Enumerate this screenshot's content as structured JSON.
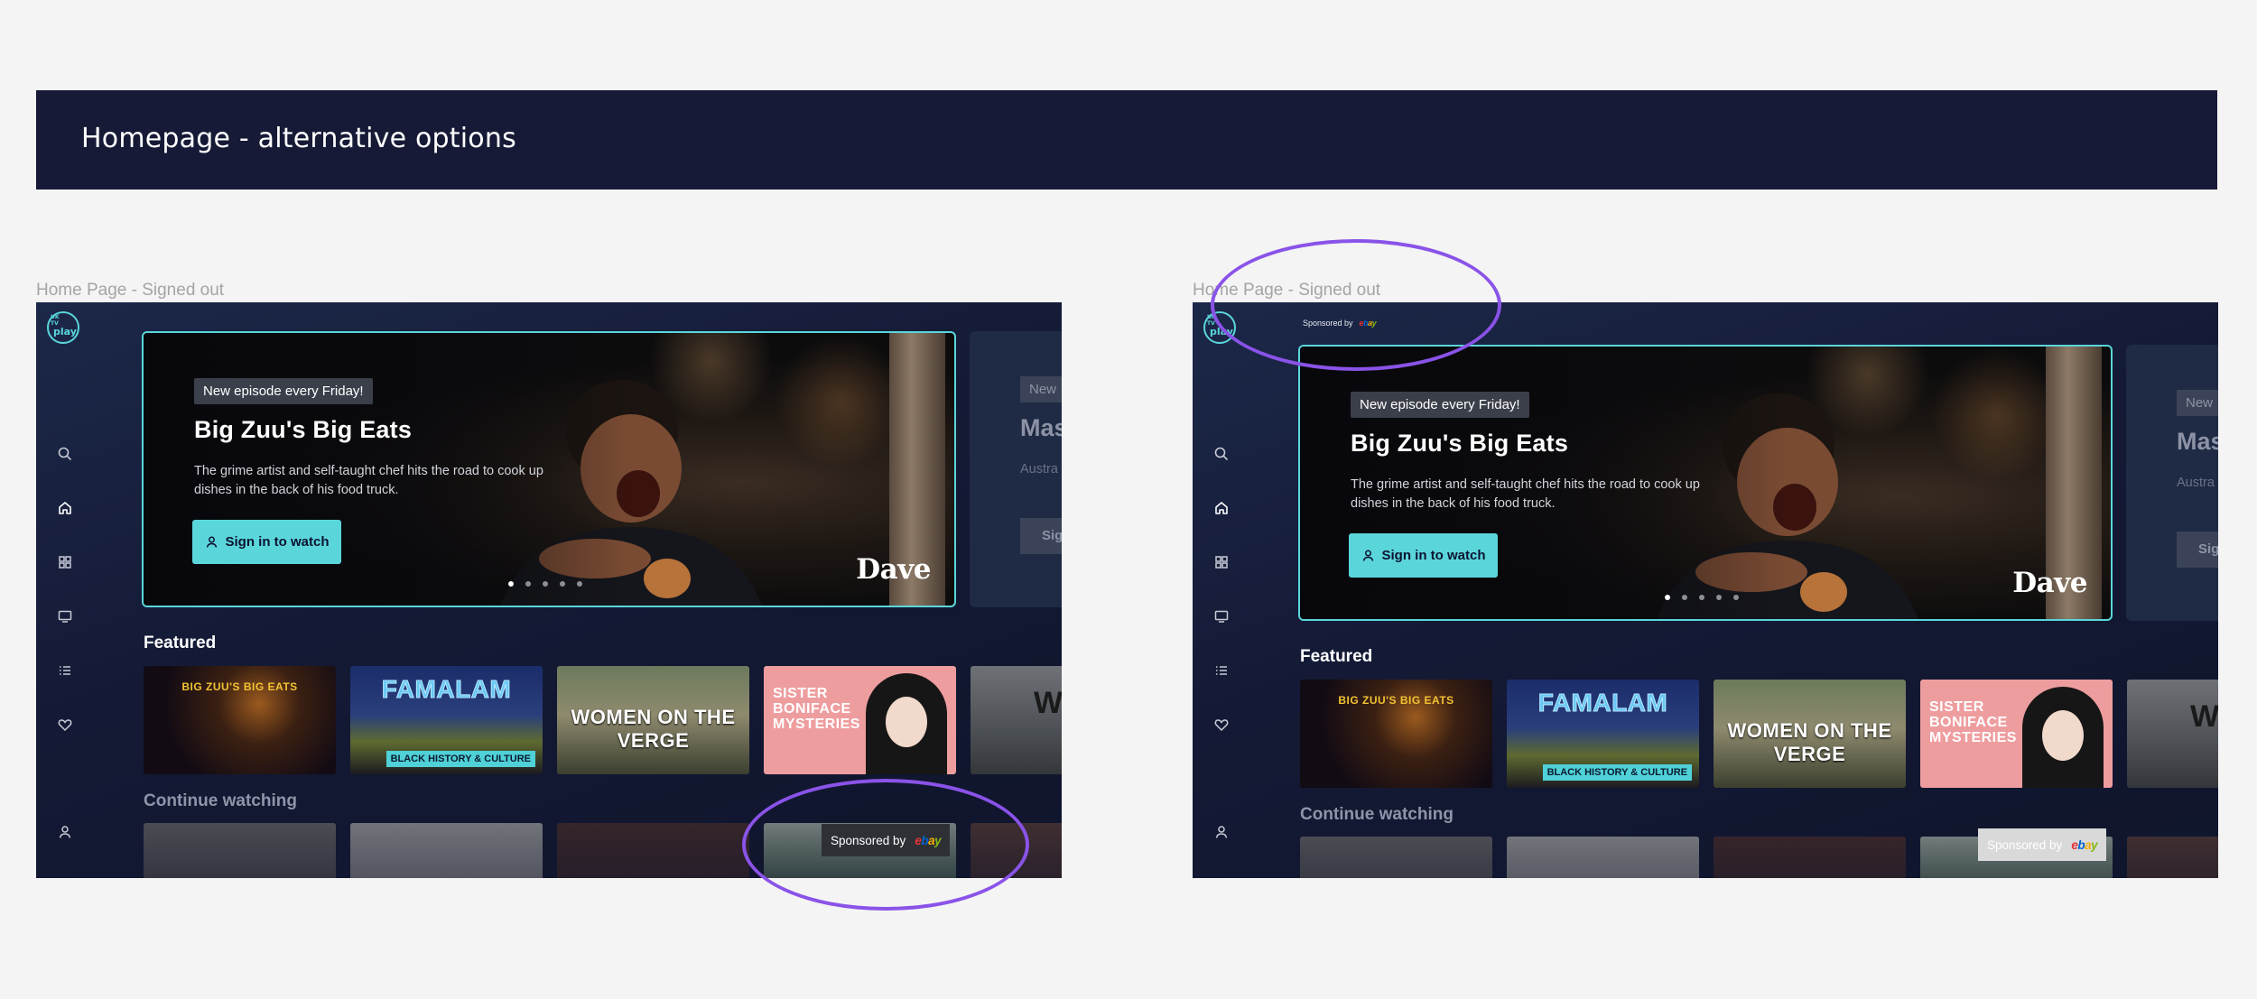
{
  "page": {
    "banner_title": "Homepage  - alternative options",
    "colors": {
      "banner_bg": "#161a36",
      "accent": "#5ad6db",
      "annotation": "#8a53e8",
      "app_bg": "#141a35"
    }
  },
  "frames": [
    {
      "caption": "Home Page - Signed out",
      "logo": {
        "top": "UK",
        "mid": "TV",
        "word": "play"
      },
      "sidebar_icons": [
        "search-icon",
        "home-icon",
        "categories-icon",
        "tv-guide-icon",
        "list-icon",
        "favourites-icon",
        "profile-icon"
      ],
      "hero": {
        "badge": "New episode every Friday!",
        "title": "Big Zuu's Big Eats",
        "description": "The grime artist and self-taught chef hits the road to cook up dishes in the back of his food truck.",
        "cta": "Sign in to watch",
        "channel": "Dave",
        "active_slide": 1,
        "slide_count": 5
      },
      "next_hero": {
        "badge": "New",
        "title": "Mas",
        "description": "Austra origina",
        "cta": "Sig"
      },
      "featured_label": "Featured",
      "featured": [
        {
          "title": "BIG ZUU'S BIG EATS"
        },
        {
          "title": "FAMALAM",
          "sub": "BLACK HISTORY & CULTURE"
        },
        {
          "title": "WOMEN ON THE VERGE"
        },
        {
          "title": "SISTER BONIFACE MYSTERIES"
        },
        {
          "title": "WA"
        }
      ],
      "continue_label": "Continue watching",
      "sponsor": {
        "text": "Sponsored by",
        "brand": "ebay"
      }
    },
    {
      "caption": "Home Page - Signed out",
      "logo": {
        "top": "UK",
        "mid": "TV",
        "word": "play"
      },
      "sidebar_icons": [
        "search-icon",
        "home-icon",
        "categories-icon",
        "tv-guide-icon",
        "list-icon",
        "favourites-icon",
        "profile-icon"
      ],
      "top_sponsor": {
        "text": "Sponsored by",
        "brand": "ebay"
      },
      "hero": {
        "badge": "New episode every Friday!",
        "title": "Big Zuu's Big Eats",
        "description": "The grime artist and self-taught chef hits the road to cook up dishes in the back of his food truck.",
        "cta": "Sign in to watch",
        "channel": "Dave",
        "active_slide": 1,
        "slide_count": 5
      },
      "next_hero": {
        "badge": "New",
        "title": "Mas",
        "description": "Austra origina",
        "cta": "Sig"
      },
      "featured_label": "Featured",
      "featured": [
        {
          "title": "BIG ZUU'S BIG EATS"
        },
        {
          "title": "FAMALAM",
          "sub": "BLACK HISTORY & CULTURE"
        },
        {
          "title": "WOMEN ON THE VERGE"
        },
        {
          "title": "SISTER BONIFACE MYSTERIES"
        },
        {
          "title": "WA"
        }
      ],
      "continue_label": "Continue watching",
      "sponsor": {
        "text": "Sponsored by",
        "brand": "ebay"
      }
    }
  ]
}
